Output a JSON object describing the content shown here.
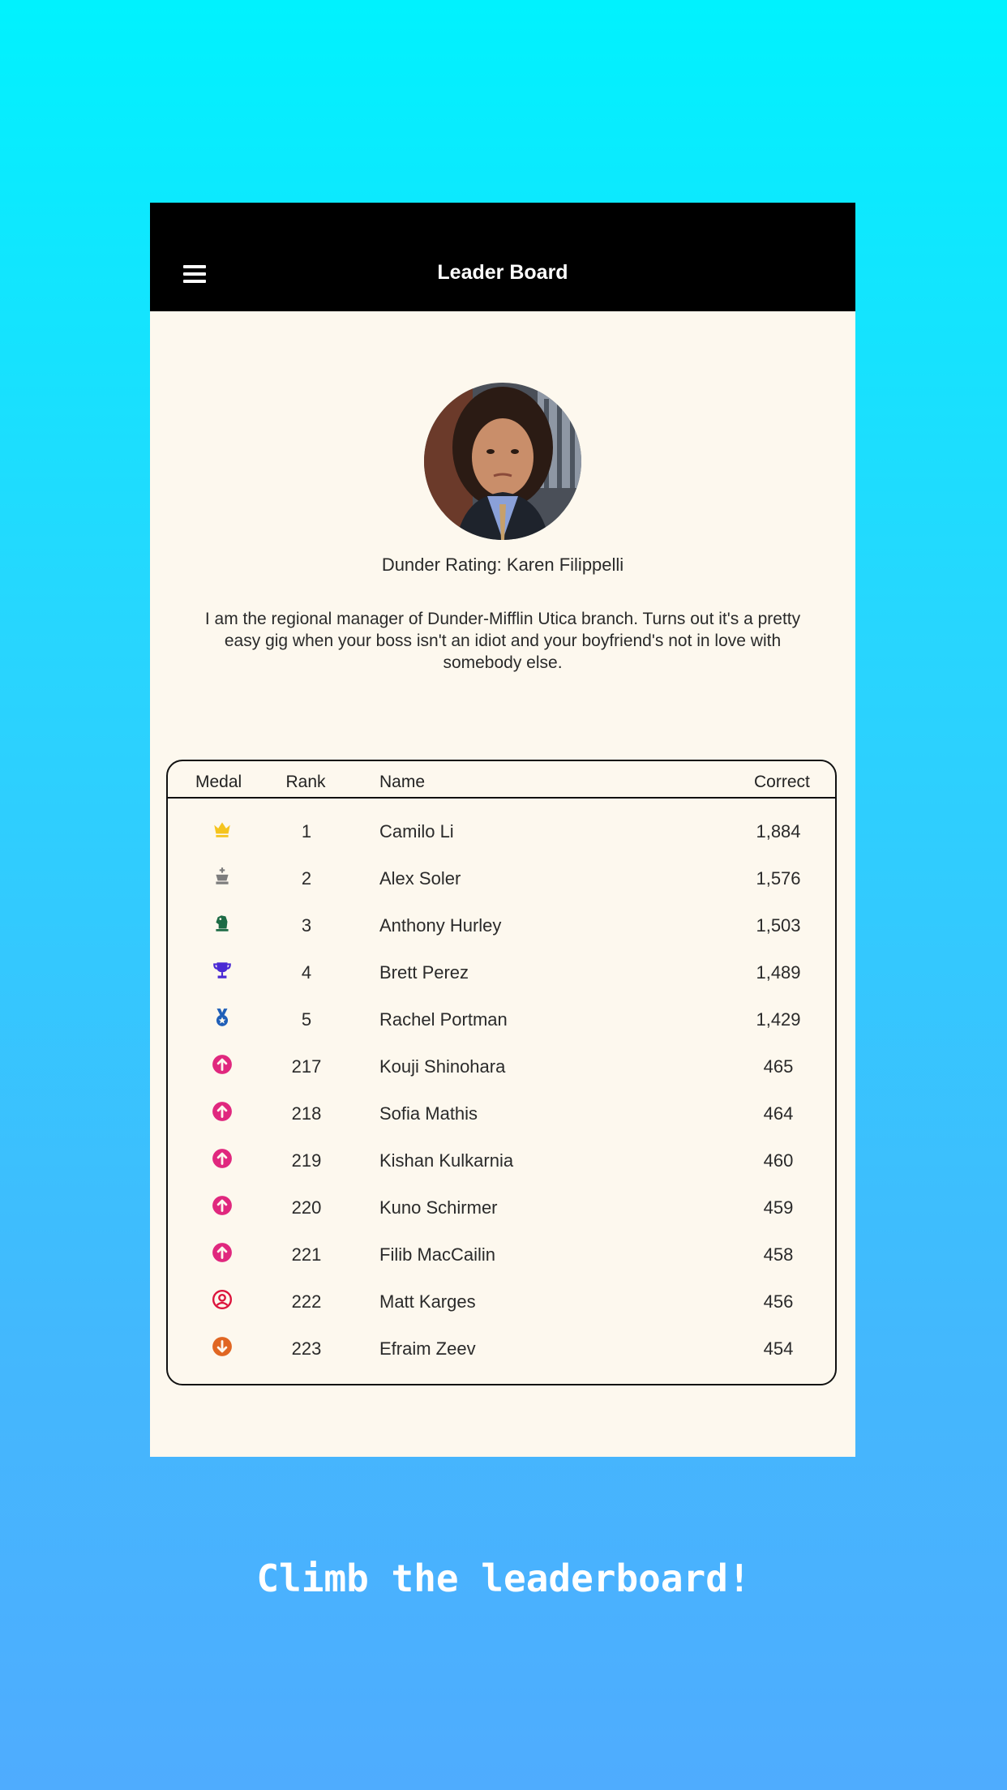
{
  "app": {
    "title": "Leader Board",
    "menu_icon": "hamburger-menu-icon"
  },
  "profile": {
    "rating_label": "Dunder Rating: Karen Filippelli",
    "bio": "I am the regional manager of Dunder-Mifflin Utica branch. Turns out it's a pretty easy gig when your boss isn't an idiot and your boyfriend's not in love with somebody else."
  },
  "leaderboard": {
    "columns": [
      "Medal",
      "Rank",
      "Name",
      "Correct"
    ],
    "rows": [
      {
        "medal": "crown-icon",
        "color": "#f5c41e",
        "rank": "1",
        "name": "Camilo Li",
        "correct": "1,884"
      },
      {
        "medal": "chess-king-icon",
        "color": "#7d7d7d",
        "rank": "2",
        "name": "Alex Soler",
        "correct": "1,576"
      },
      {
        "medal": "chess-knight-icon",
        "color": "#1d6b45",
        "rank": "3",
        "name": "Anthony Hurley",
        "correct": "1,503"
      },
      {
        "medal": "trophy-icon",
        "color": "#4a2ad4",
        "rank": "4",
        "name": "Brett Perez",
        "correct": "1,489"
      },
      {
        "medal": "medal-icon",
        "color": "#1f5fb8",
        "rank": "5",
        "name": "Rachel Portman",
        "correct": "1,429"
      },
      {
        "medal": "arrow-up-circle-icon",
        "color": "#e0287e",
        "rank": "217",
        "name": "Kouji Shinohara",
        "correct": "465"
      },
      {
        "medal": "arrow-up-circle-icon",
        "color": "#e0287e",
        "rank": "218",
        "name": "Sofia Mathis",
        "correct": "464"
      },
      {
        "medal": "arrow-up-circle-icon",
        "color": "#e0287e",
        "rank": "219",
        "name": "Kishan Kulkarnia",
        "correct": "460"
      },
      {
        "medal": "arrow-up-circle-icon",
        "color": "#e0287e",
        "rank": "220",
        "name": "Kuno Schirmer",
        "correct": "459"
      },
      {
        "medal": "arrow-up-circle-icon",
        "color": "#e0287e",
        "rank": "221",
        "name": "Filib MacCailin",
        "correct": "458"
      },
      {
        "medal": "user-circle-icon",
        "color": "#dc143c",
        "rank": "222",
        "name": "Matt Karges",
        "correct": "456"
      },
      {
        "medal": "arrow-down-circle-icon",
        "color": "#e06622",
        "rank": "223",
        "name": "Efraim Zeev",
        "correct": "454"
      }
    ]
  },
  "tagline": "Climb the leaderboard!",
  "colors": {
    "background_top": "#00f2fe",
    "background_bottom": "#4facfe",
    "appbar": "#000000",
    "card": "#fdf8ee"
  }
}
